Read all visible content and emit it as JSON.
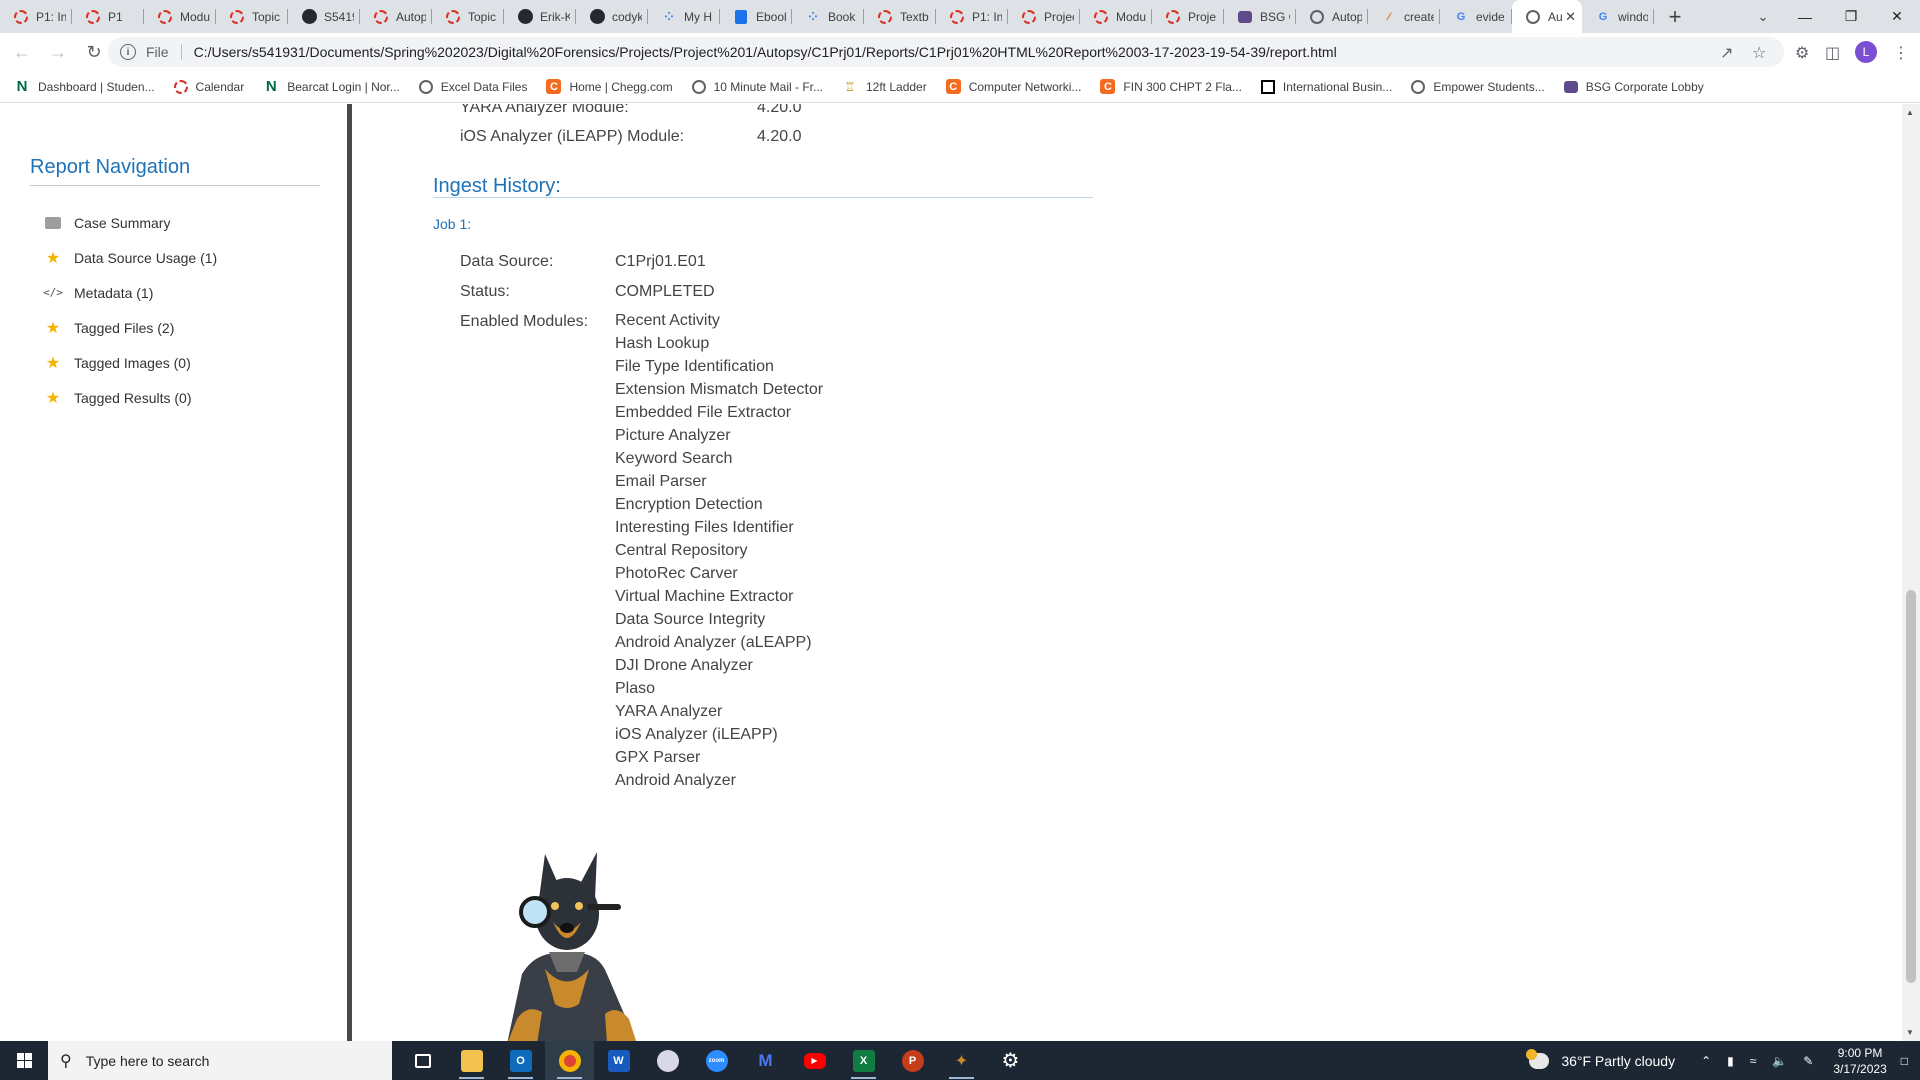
{
  "browser": {
    "tabs": [
      {
        "title": "P1: Ini",
        "icon": "autopsy-ring-icon"
      },
      {
        "title": "P1",
        "icon": "autopsy-ring-icon"
      },
      {
        "title": "Modu",
        "icon": "autopsy-ring-icon"
      },
      {
        "title": "Topic",
        "icon": "autopsy-ring-icon"
      },
      {
        "title": "S5419",
        "icon": "github-icon"
      },
      {
        "title": "Autop",
        "icon": "autopsy-ring-icon"
      },
      {
        "title": "Topic",
        "icon": "autopsy-ring-icon"
      },
      {
        "title": "Erik-K",
        "icon": "github-icon"
      },
      {
        "title": "codyk",
        "icon": "github-icon"
      },
      {
        "title": "My H",
        "icon": "dots-icon"
      },
      {
        "title": "Ebool",
        "icon": "book-icon"
      },
      {
        "title": "Book",
        "icon": "dots-icon"
      },
      {
        "title": "Textb",
        "icon": "autopsy-ring-icon"
      },
      {
        "title": "P1: In",
        "icon": "autopsy-ring-icon"
      },
      {
        "title": "Projec",
        "icon": "autopsy-ring-icon"
      },
      {
        "title": "Modu",
        "icon": "autopsy-ring-icon"
      },
      {
        "title": "Proje",
        "icon": "autopsy-ring-icon"
      },
      {
        "title": "BSG C",
        "icon": "bsg-icon"
      },
      {
        "title": "Autop",
        "icon": "globe-icon"
      },
      {
        "title": "create",
        "icon": "spark-icon"
      },
      {
        "title": "evide",
        "icon": "google-icon"
      },
      {
        "title": "Au",
        "icon": "globe-icon",
        "active": true
      },
      {
        "title": "windo",
        "icon": "google-icon"
      }
    ],
    "file_label": "File",
    "url": "C:/Users/s541931/Documents/Spring%202023/Digital%20Forensics/Projects/Project%201/Autopsy/C1Prj01/Reports/C1Prj01%20HTML%20Report%2003-17-2023-19-54-39/report.html",
    "profile_initial": "L",
    "bookmarks": [
      {
        "label": "Dashboard | Studen...",
        "icon": "n-icon"
      },
      {
        "label": "Calendar",
        "icon": "ring-icon"
      },
      {
        "label": "Bearcat Login | Nor...",
        "icon": "n-icon"
      },
      {
        "label": "Excel Data Files",
        "icon": "globe-icon"
      },
      {
        "label": "Home | Chegg.com",
        "icon": "chegg-icon"
      },
      {
        "label": "10 Minute Mail - Fr...",
        "icon": "globe-icon"
      },
      {
        "label": "12ft Ladder",
        "icon": "ladder-icon"
      },
      {
        "label": "Computer Networki...",
        "icon": "chegg-icon"
      },
      {
        "label": "FIN 300 CHPT 2 Fla...",
        "icon": "chegg-icon"
      },
      {
        "label": "International Busin...",
        "icon": "square-icon"
      },
      {
        "label": "Empower Students...",
        "icon": "globe-icon"
      },
      {
        "label": "BSG Corporate Lobby",
        "icon": "bsg-icon"
      }
    ]
  },
  "report": {
    "nav": {
      "title": "Report Navigation",
      "items": [
        {
          "label": "Case Summary",
          "icon": "folder-icon"
        },
        {
          "label": "Data Source Usage (1)",
          "icon": "star-icon"
        },
        {
          "label": "Metadata (1)",
          "icon": "code-icon"
        },
        {
          "label": "Tagged Files (2)",
          "icon": "star-icon"
        },
        {
          "label": "Tagged Images (0)",
          "icon": "star-icon"
        },
        {
          "label": "Tagged Results (0)",
          "icon": "star-icon"
        }
      ]
    },
    "versions": [
      {
        "label": "YARA Analyzer Module:",
        "value": "4.20.0"
      },
      {
        "label": "iOS Analyzer (iLEAPP) Module:",
        "value": "4.20.0"
      }
    ],
    "ingest_title": "Ingest History:",
    "job_label": "Job 1:",
    "data_source_label": "Data Source:",
    "data_source_value": "C1Prj01.E01",
    "status_label": "Status:",
    "status_value": "COMPLETED",
    "modules_label": "Enabled Modules:",
    "modules": [
      "Recent Activity",
      "Hash Lookup",
      "File Type Identification",
      "Extension Mismatch Detector",
      "Embedded File Extractor",
      "Picture Analyzer",
      "Keyword Search",
      "Email Parser",
      "Encryption Detection",
      "Interesting Files Identifier",
      "Central Repository",
      "PhotoRec Carver",
      "Virtual Machine Extractor",
      "Data Source Integrity",
      "Android Analyzer (aLEAPP)",
      "DJI Drone Analyzer",
      "Plaso",
      "YARA Analyzer",
      "iOS Analyzer (iLEAPP)",
      "GPX Parser",
      "Android Analyzer"
    ]
  },
  "taskbar": {
    "search_placeholder": "Type here to search",
    "weather": "36°F  Partly cloudy",
    "time": "9:00 PM",
    "date": "3/17/2023"
  },
  "colors": {
    "report_accent": "#1f72b8",
    "taskbar_bg": "#1c2733",
    "tabstrip_bg": "#dee1e6"
  }
}
